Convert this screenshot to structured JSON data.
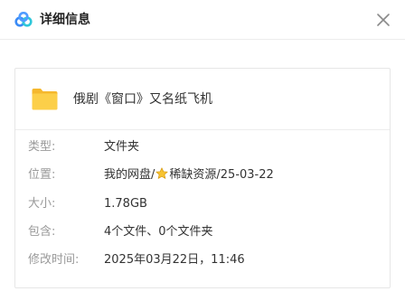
{
  "window": {
    "title": "详细信息",
    "logo_icon": "baidu-netdisk-logo",
    "close_icon": "close-icon"
  },
  "file": {
    "icon": "folder-icon",
    "icon_color": "#F9C93B",
    "name": "俄剧《窗口》又名纸飞机"
  },
  "details": {
    "type": {
      "label": "类型:",
      "value": "文件夹"
    },
    "location": {
      "label": "位置:",
      "path_prefix": "我的网盘/",
      "star_icon": "star-icon",
      "path_suffix": "稀缺资源/25-03-22"
    },
    "size": {
      "label": "大小:",
      "value": "1.78GB"
    },
    "contains": {
      "label": "包含:",
      "value": "4个文件、0个文件夹"
    },
    "modified": {
      "label": "修改时间:",
      "value": "2025年03月22日，11:46"
    }
  },
  "colors": {
    "label_text": "#9a9a9a",
    "value_text": "#333333",
    "star_fill": "#F7C331",
    "logo_blue": "#3B8BF6",
    "logo_cyan": "#2FC7D9"
  }
}
